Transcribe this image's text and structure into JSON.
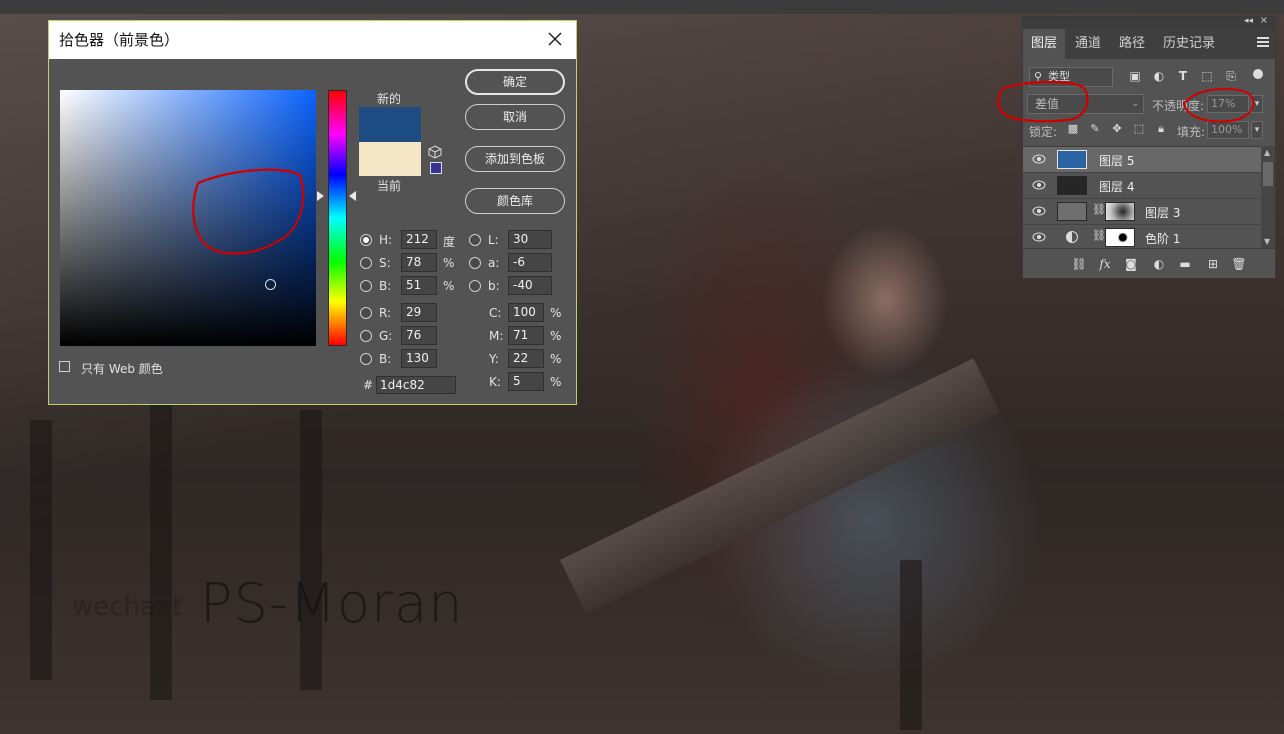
{
  "canvas": {
    "watermark_small": "wechaat",
    "watermark_large": "PS-Moran",
    "watermark_faint": ""
  },
  "color_picker": {
    "title": "拾色器（前景色）",
    "label_new": "新的",
    "label_current": "当前",
    "new_color": "#1d4c82",
    "current_color": "#f6e6c8",
    "buttons": {
      "ok": "确定",
      "cancel": "取消",
      "add_swatch": "添加到色板",
      "color_libraries": "颜色库"
    },
    "hsb": {
      "h": {
        "label": "H:",
        "value": "212",
        "unit": "度"
      },
      "s": {
        "label": "S:",
        "value": "78",
        "unit": "%"
      },
      "b": {
        "label": "B:",
        "value": "51",
        "unit": "%"
      }
    },
    "lab": {
      "l": {
        "label": "L:",
        "value": "30"
      },
      "a": {
        "label": "a:",
        "value": "-6"
      },
      "b": {
        "label": "b:",
        "value": "-40"
      }
    },
    "rgb": {
      "r": {
        "label": "R:",
        "value": "29"
      },
      "g": {
        "label": "G:",
        "value": "76"
      },
      "b": {
        "label": "B:",
        "value": "130"
      }
    },
    "cmyk": {
      "c": {
        "label": "C:",
        "value": "100",
        "unit": "%"
      },
      "m": {
        "label": "M:",
        "value": "71",
        "unit": "%"
      },
      "y": {
        "label": "Y:",
        "value": "22",
        "unit": "%"
      },
      "k": {
        "label": "K:",
        "value": "5",
        "unit": "%"
      }
    },
    "hex_label": "#",
    "hex_value": "1d4c82",
    "web_only_label": "只有 Web 颜色",
    "web_only_checked": false
  },
  "layers_panel": {
    "tabs": [
      {
        "label": "图层",
        "active": true
      },
      {
        "label": "通道",
        "active": false
      },
      {
        "label": "路径",
        "active": false
      },
      {
        "label": "历史记录",
        "active": false
      }
    ],
    "filter_label": "类型",
    "blend_mode": "差值",
    "opacity_label": "不透明度:",
    "opacity_value": "17%",
    "lock_label": "锁定:",
    "fill_label": "填充:",
    "fill_value": "100%",
    "layers": [
      {
        "name": "图层 5",
        "selected": true,
        "thumb": "#2a64a2"
      },
      {
        "name": "图层 4",
        "selected": false,
        "thumb": "#262626"
      },
      {
        "name": "图层 3",
        "selected": false,
        "thumb": "#6f6f6f"
      },
      {
        "name": "色阶 1",
        "selected": false,
        "thumb": "#ffffff"
      }
    ]
  },
  "colors": {
    "annotation_red": "#d00000",
    "dialog_border": "#b5d66a"
  }
}
